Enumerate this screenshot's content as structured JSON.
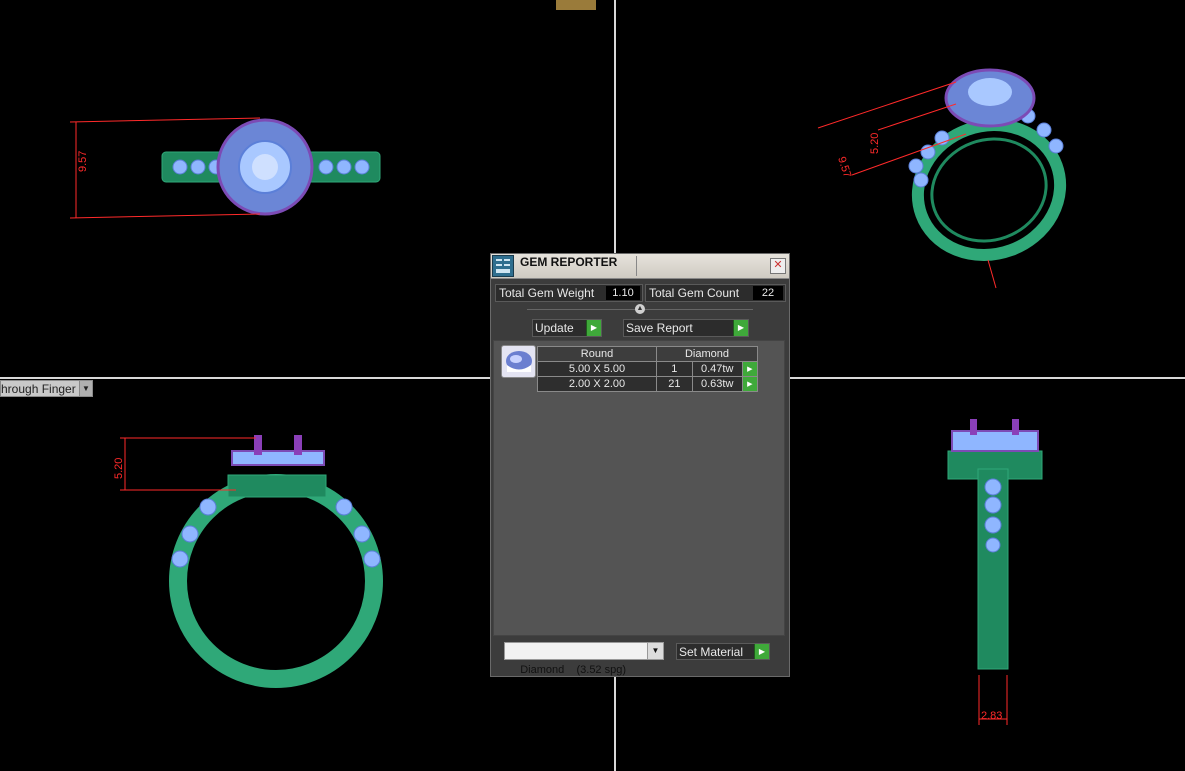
{
  "viewports": {
    "label_dropdown": "hrough Finger"
  },
  "dimensions": {
    "top_view_height": "9.57",
    "perspective_a": "9.57",
    "perspective_b": "5.20",
    "front_height": "5.20",
    "side_width": "2.83"
  },
  "dialog": {
    "title": "GEM REPORTER",
    "close_glyph": "✕",
    "total_gem_weight_label": "Total Gem Weight",
    "total_gem_weight_value": "1.10",
    "total_gem_count_label": "Total Gem Count",
    "total_gem_count_value": "22",
    "update_label": "Update",
    "save_report_label": "Save Report",
    "table": {
      "headers": [
        "Round",
        "Diamond"
      ],
      "rows": [
        {
          "size": "5.00 X 5.00",
          "count": "1",
          "weight": "0.47tw"
        },
        {
          "size": "2.00 X 2.00",
          "count": "21",
          "weight": "0.63tw"
        }
      ]
    },
    "material_select": "Diamond    (3.52 spg)",
    "set_material_label": "Set Material"
  },
  "colors": {
    "metal": "#2fa878",
    "stone": "#8fb6ff",
    "prong": "#8a3fb8",
    "dimension": "#ff2a2a",
    "accent_green": "#3fa93a"
  },
  "icons": {
    "title": "gem-reporter-icon",
    "go": "play-arrow-icon",
    "dropdown": "chevron-down-icon",
    "collapse": "chevron-up-icon"
  }
}
